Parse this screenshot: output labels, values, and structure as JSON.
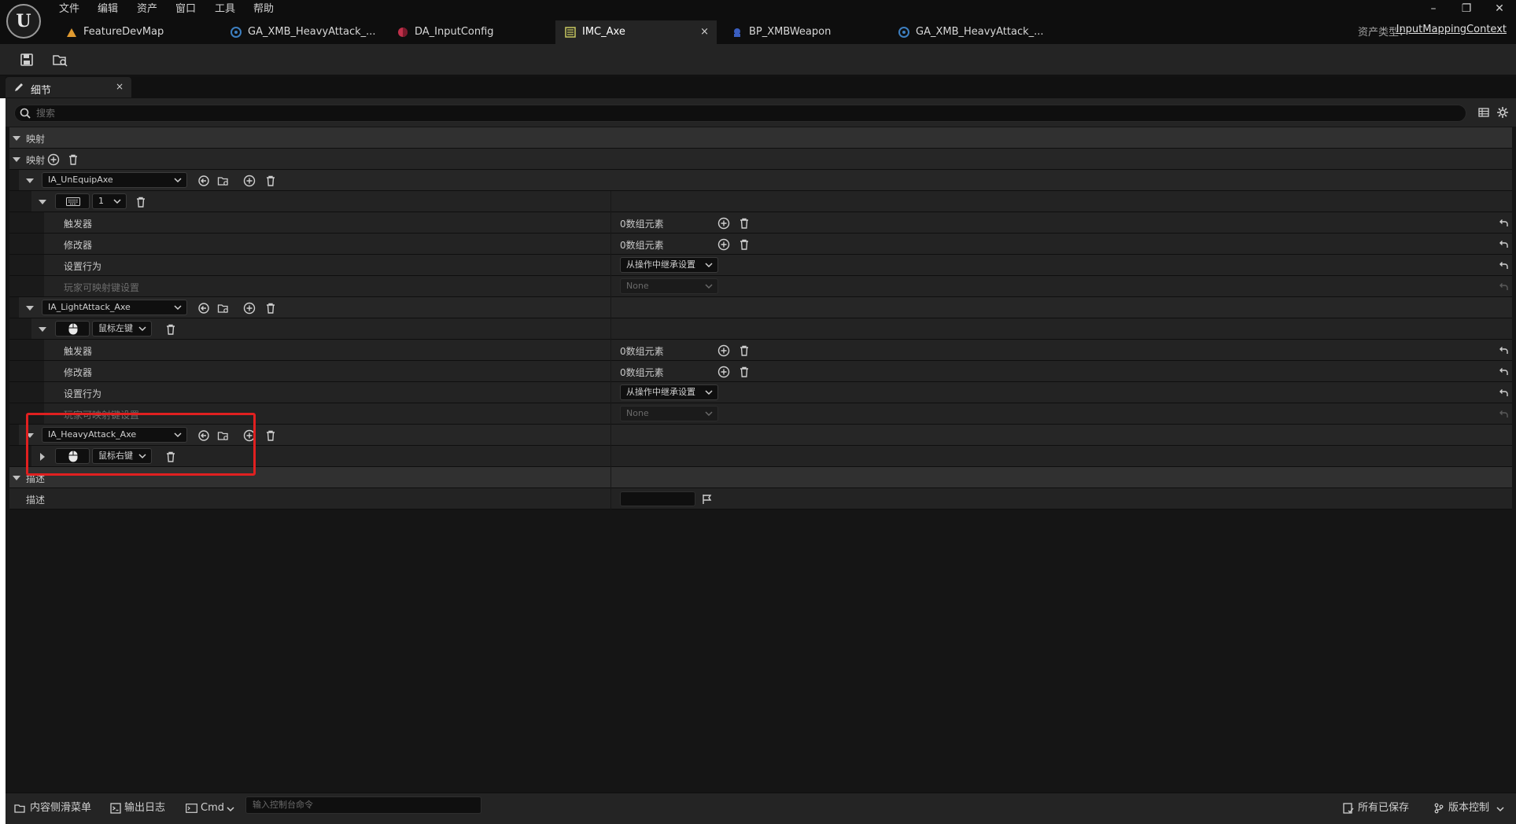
{
  "menu": [
    "文件",
    "编辑",
    "资产",
    "窗口",
    "工具",
    "帮助"
  ],
  "tabs": [
    {
      "label": "FeatureDevMap",
      "icon": "level-icon"
    },
    {
      "label": "GA_XMB_HeavyAttack_...",
      "icon": "blueprint-icon"
    },
    {
      "label": "DA_InputConfig",
      "icon": "data-asset-icon"
    },
    {
      "label": "IMC_Axe",
      "icon": "input-mapping-icon",
      "active": true,
      "close": "×"
    },
    {
      "label": "BP_XMBWeapon",
      "icon": "blueprint-icon"
    },
    {
      "label": "GA_XMB_HeavyAttack_...",
      "icon": "blueprint-icon"
    }
  ],
  "asset_type": {
    "label": "资产类型：",
    "value": "InputMappingContext"
  },
  "window_controls": [
    "–",
    "❐",
    "✕"
  ],
  "details": {
    "tab_label": "细节",
    "tab_close": "×",
    "search_placeholder": "搜索",
    "category_mappings": "映射",
    "mappings_label": "映射",
    "category_description": "描述",
    "description_label": "描述"
  },
  "mappings": [
    {
      "action": "IA_UnEquipAxe",
      "key_label": "1",
      "key_icon": "keyboard-icon",
      "properties": [
        {
          "label": "触发器",
          "value": "0数组元素"
        },
        {
          "label": "修改器",
          "value": "0数组元素"
        },
        {
          "label": "设置行为",
          "value": "从操作中继承设置"
        },
        {
          "label": "玩家可映射键设置",
          "value": "None"
        }
      ]
    },
    {
      "action": "IA_LightAttack_Axe",
      "key_label": "鼠标左键",
      "key_icon": "mouse-icon",
      "properties": [
        {
          "label": "触发器",
          "value": "0数组元素"
        },
        {
          "label": "修改器",
          "value": "0数组元素"
        },
        {
          "label": "设置行为",
          "value": "从操作中继承设置"
        },
        {
          "label": "玩家可映射键设置",
          "value": "None"
        }
      ]
    },
    {
      "action": "IA_HeavyAttack_Axe",
      "key_label": "鼠标右键",
      "key_icon": "mouse-icon"
    }
  ],
  "bottom": {
    "content_drawer": "内容侧滑菜单",
    "output_log": "输出日志",
    "cmd": "Cmd",
    "console_placeholder": "输入控制台命令",
    "all_saved": "所有已保存",
    "source_control": "版本控制"
  },
  "colors": {
    "highlight": "#e02020",
    "background": "#151515",
    "panel": "#242424"
  }
}
